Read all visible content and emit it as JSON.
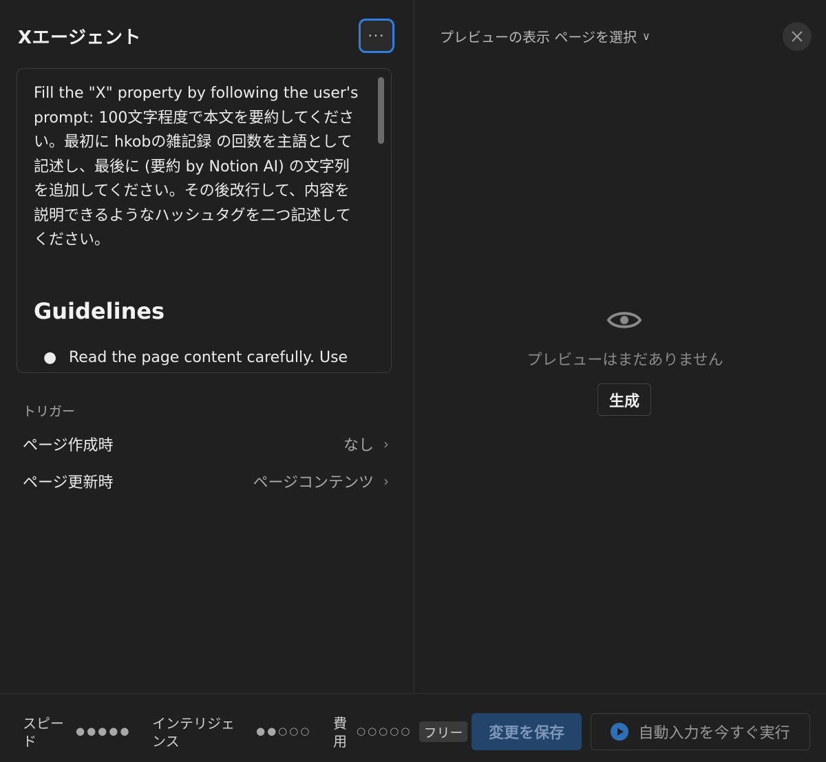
{
  "agent": {
    "title": "Xエージェント",
    "more_label": "···"
  },
  "prompt": {
    "text": "Fill the \"X\" property by following the user's prompt: 100文字程度で本文を要約してください。最初に hkobの雑記録 の回数を主語として記述し、最後に (要約 by Notion AI) の文字列を追加してください。その後改行して、内容を説明できるようなハッシュタグを二つ記述してください。",
    "heading": "Guidelines",
    "bullet": "Read the page content carefully. Use"
  },
  "triggers": {
    "label": "トリガー",
    "rows": [
      {
        "name": "ページ作成時",
        "value": "なし"
      },
      {
        "name": "ページ更新時",
        "value": "ページコンテンツ"
      }
    ]
  },
  "preview": {
    "select_label": "プレビューの表示 ページを選択",
    "empty_text": "プレビューはまだありません",
    "generate_label": "生成"
  },
  "footer": {
    "speed_label": "スピード",
    "speed_dots": "●●●●●",
    "intelligence_label": "インテリジェンス",
    "intelligence_dots": "●●○○○",
    "cost_label": "費用",
    "cost_dots": "○○○○○",
    "free_badge": "フリー",
    "save_label": "変更を保存",
    "run_label": "自動入力を今すぐ実行"
  },
  "colors": {
    "background": "#202020",
    "accent_blue": "#2f7ee0",
    "save_bg": "#23446b"
  },
  "icons": {
    "more": "more-icon",
    "close": "close-icon",
    "eye": "eye-icon",
    "chevron": "chevron-right-icon",
    "play": "play-icon"
  }
}
